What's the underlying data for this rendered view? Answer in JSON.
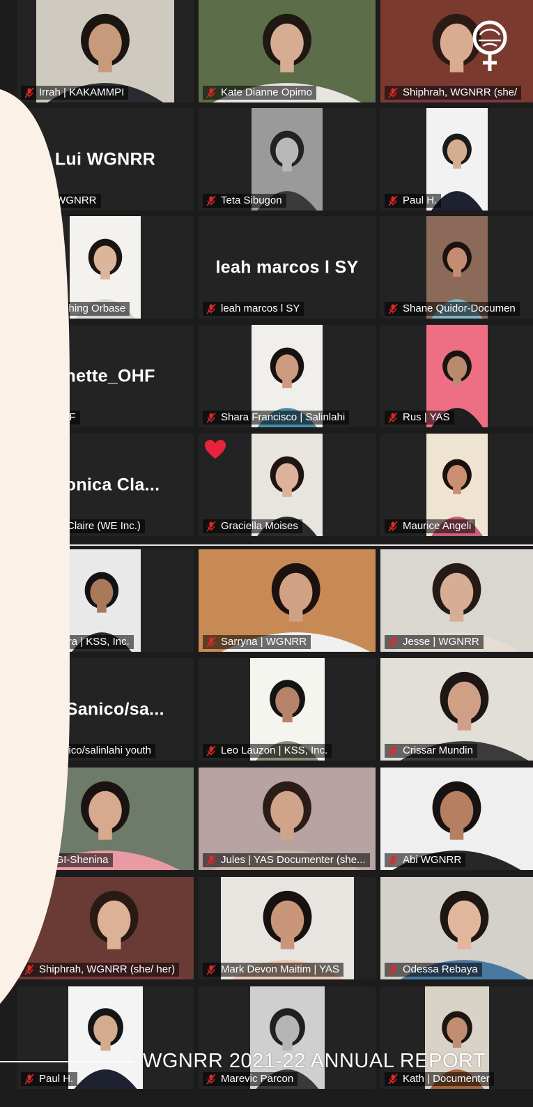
{
  "colors": {
    "background": "#1c1c1c",
    "tile": "#232323",
    "mute_icon": "#e02828",
    "cream_shape": "#fbf1e7",
    "heart": "#e8233a"
  },
  "footer": {
    "title": "WGNRR 2021-22 ANNUAL REPORT"
  },
  "tiles": [
    {
      "label": "Irrah | KAKAMMPI",
      "kind": "photo",
      "photo": {
        "bg": "#cfcac0",
        "skin": "#c79a7c",
        "hair": "#1b1410",
        "top": "#2a2a30",
        "pos": 0.5,
        "w": 0.78
      }
    },
    {
      "label": "Kate Dianne Opimo",
      "kind": "photo",
      "photo": {
        "bg": "#5c6d4a",
        "skin": "#d6ad92",
        "hair": "#1f1712",
        "top": "#e8e4df",
        "pos": 0.5,
        "w": 1.0
      }
    },
    {
      "label": "Shiphrah, WGNRR (she/",
      "kind": "photo",
      "logo": true,
      "icons": [
        "venus-logo-icon"
      ],
      "photo": {
        "bg": "#7a3a30",
        "skin": "#d9ab90",
        "hair": "#2c1a14",
        "top": "#7a3a3c",
        "pos": 0.5,
        "w": 1.0
      }
    },
    {
      "label": "Lui WGNRR",
      "kind": "text",
      "big": "Lui WGNRR"
    },
    {
      "label": "Teta Sibugon",
      "kind": "photo",
      "photo": {
        "bg": "#9a9a9a",
        "skin": "#b8b8b8",
        "hair": "#222222",
        "top": "#3a3a3a",
        "pos": 0.5,
        "w": 0.4
      }
    },
    {
      "label": "Paul H.",
      "kind": "photo",
      "photo": {
        "bg": "#f2f2f2",
        "skin": "#d5ad8f",
        "hair": "#1a1a1a",
        "top": "#1d2130",
        "pos": 0.5,
        "w": 0.4
      }
    },
    {
      "label": "wen Ching Orbase",
      "kind": "photo",
      "photo": {
        "bg": "#f4f2ef",
        "skin": "#dcb59a",
        "hair": "#1a1512",
        "top": "#d6d6d6",
        "pos": 0.5,
        "w": 0.4
      }
    },
    {
      "label": "leah marcos l SY",
      "kind": "text",
      "big": "leah marcos l SY"
    },
    {
      "label": "Shane Quidor-Documen",
      "kind": "photo",
      "photo": {
        "bg": "#8b6a5a",
        "skin": "#c48c72",
        "hair": "#1b1210",
        "top": "#7fb3c0",
        "pos": 0.5,
        "w": 0.4
      }
    },
    {
      "label": "te_OHF",
      "kind": "text",
      "big": "anette_OHF"
    },
    {
      "label": "Shara Francisco | Salinlahi",
      "kind": "photo",
      "photo": {
        "bg": "#f0efeb",
        "skin": "#cc9a7e",
        "hair": "#171211",
        "top": "#4a8fa8",
        "pos": 0.5,
        "w": 0.4
      }
    },
    {
      "label": "Rus | YAS",
      "kind": "photo",
      "photo": {
        "bg": "#ee6e84",
        "skin": "#b98a6c",
        "hair": "#1a1410",
        "top": "#1f1f1f",
        "pos": 0.5,
        "w": 0.4
      }
    },
    {
      "label": "onica Claire (WE Inc.)",
      "kind": "text",
      "big": "Monica Cla..."
    },
    {
      "label": "Graciella Moises",
      "kind": "photo",
      "heart": true,
      "photo": {
        "bg": "#e8e4de",
        "skin": "#dcb29a",
        "hair": "#1e1412",
        "top": "#2b2b2b",
        "pos": 0.5,
        "w": 0.4
      }
    },
    {
      "label": "Maurice Angeli",
      "kind": "photo",
      "photo": {
        "bg": "#efe3d2",
        "skin": "#c98f70",
        "hair": "#1a110e",
        "top": "#c65f78",
        "pos": 0.5,
        "w": 0.4
      }
    },
    {
      "label": "ne Alera | KSS, Inc.",
      "kind": "photo",
      "photo": {
        "bg": "#e9e9e9",
        "skin": "#a9795c",
        "hair": "#121212",
        "top": "#2a2a2a",
        "pos": 0.45,
        "w": 0.4
      }
    },
    {
      "label": "Sarryna | WGNRR",
      "kind": "photo",
      "photo": {
        "bg": "#c88a55",
        "skin": "#d1a184",
        "hair": "#1b1210",
        "top": "#f0f0f0",
        "pos": 0.55,
        "w": 1.0
      }
    },
    {
      "label": "Jesse | WGNRR",
      "kind": "photo",
      "photo": {
        "bg": "#dad6d0",
        "skin": "#d7ad95",
        "hair": "#251a15",
        "top": "#e5ddd3",
        "pos": 0.5,
        "w": 1.0
      }
    },
    {
      "label": "ai Sanico/salinlahi youth",
      "kind": "text",
      "big": "ai  Sanico/sa..."
    },
    {
      "label": "Leo Lauzon | KSS, Inc.",
      "kind": "photo",
      "photo": {
        "bg": "#f5f5f0",
        "skin": "#b6836a",
        "hair": "#141414",
        "top": "#8c8c7a",
        "pos": 0.5,
        "w": 0.42
      }
    },
    {
      "label": "Crissar Mundin",
      "kind": "photo",
      "photo": {
        "bg": "#e2ded8",
        "skin": "#cf9f86",
        "hair": "#1e1614",
        "top": "#3b3b3b",
        "pos": 0.55,
        "w": 1.0
      }
    },
    {
      "label": "WAGI-Shenina",
      "kind": "photo",
      "photo": {
        "bg": "#6e7a6a",
        "skin": "#d7aa8f",
        "hair": "#1a1312",
        "top": "#e99aa2",
        "pos": 0.5,
        "w": 1.0
      }
    },
    {
      "label": "Jules | YAS Documenter (she...",
      "kind": "photo",
      "photo": {
        "bg": "#b8a2a2",
        "skin": "#cfa48a",
        "hair": "#2a1d18",
        "top": "#c9b7aa",
        "pos": 0.5,
        "w": 1.0
      }
    },
    {
      "label": "Abi WGNRR",
      "kind": "photo",
      "photo": {
        "bg": "#efefef",
        "skin": "#b67f62",
        "hair": "#161212",
        "top": "#272727",
        "pos": 0.5,
        "w": 1.0
      }
    },
    {
      "label": "Shiphrah, WGNRR (she/ her)",
      "kind": "photo",
      "photo": {
        "bg": "#6a3a34",
        "skin": "#ddb196",
        "hair": "#2a1a15",
        "top": "#7a3a3c",
        "pos": 0.55,
        "w": 1.0
      }
    },
    {
      "label": "Mark Devon Maitim | YAS",
      "kind": "photo",
      "photo": {
        "bg": "#e8e4e0",
        "skin": "#c99679",
        "hair": "#171211",
        "top": "#ecc7b7",
        "pos": 0.5,
        "w": 0.75
      }
    },
    {
      "label": "Odessa Rebaya",
      "kind": "photo",
      "photo": {
        "bg": "#d4d0ca",
        "skin": "#e0b69d",
        "hair": "#1e1612",
        "top": "#4a79a0",
        "pos": 0.55,
        "w": 1.0
      }
    },
    {
      "label": "Paul H.",
      "kind": "photo",
      "photo": {
        "bg": "#f4f4f4",
        "skin": "#d3ab8e",
        "hair": "#151515",
        "top": "#1d2130",
        "pos": 0.5,
        "w": 0.42
      }
    },
    {
      "label": "Marevic Parcon",
      "kind": "photo",
      "photo": {
        "bg": "#cfcfcf",
        "skin": "#b5b5b5",
        "hair": "#202020",
        "top": "#3a3a3a",
        "pos": 0.5,
        "w": 0.42
      }
    },
    {
      "label": "Kath | Documenter",
      "kind": "photo",
      "photo": {
        "bg": "#d9d3c7",
        "skin": "#c28e72",
        "hair": "#1c1512",
        "top": "#a4653c",
        "pos": 0.5,
        "w": 0.42
      }
    }
  ]
}
